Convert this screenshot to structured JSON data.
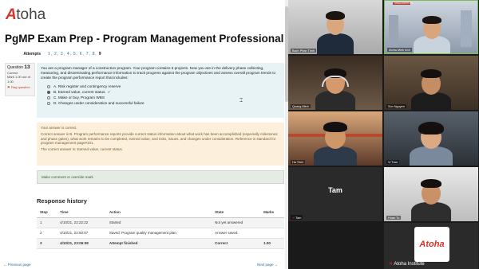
{
  "app": {
    "logo_mark": "A",
    "logo_text": "toha",
    "page_title": "PgMP Exam Prep - Program Management Professional"
  },
  "attempts": {
    "label": "Attempts",
    "numbers": "1, 2, 3, 4, 5, 6, 7, 8,",
    "current": "9"
  },
  "question_info": {
    "prefix": "Question",
    "number": "13",
    "status": "Correct",
    "mark": "Mark 1.00 out of 1.00",
    "flag": "Flag question"
  },
  "question": {
    "text": "You are a program manager of a construction program. Your program contains 5 projects. Now you are in the delivery phase collecting, measuring, and disseminating performance information to track progress against the program objectives and assess overall program trends to create the program performance report that includes:",
    "options": [
      {
        "letter": "A.",
        "text": "Risk register and contingency reserve",
        "selected": false
      },
      {
        "letter": "B.",
        "text": "Earned value, current status.",
        "selected": true,
        "mark": "✓"
      },
      {
        "letter": "C.",
        "text": "Make or buy, Program WBS",
        "selected": false
      },
      {
        "letter": "D.",
        "text": "Changes under consideration and successful failure",
        "selected": false
      }
    ]
  },
  "feedback": {
    "line1": "Your answer is correct.",
    "line2": "Correct answer is B. Program performance reports provide current status information about what work has been accomplished (especially milestones and phase gates), what work remains to be completed, earned value, and risks, issues, and changes under consideration. Reference is standard for program management page#101.",
    "line3": "The correct answer is: Earned value, current status."
  },
  "comment": {
    "label": "Make comment or override mark"
  },
  "response_history": {
    "title": "Response history",
    "columns": [
      "Step",
      "Time",
      "Action",
      "State",
      "Marks"
    ],
    "rows": [
      {
        "step": "1",
        "time": "4/10/21, 22:22:22",
        "action": "Started",
        "state": "Not yet answered",
        "marks": ""
      },
      {
        "step": "2",
        "time": "4/10/21, 22:50:07",
        "action": "Saved: Program quality management plan.",
        "state": "Answer saved",
        "marks": ""
      },
      {
        "step": "3",
        "time": "4/10/21, 23:06:08",
        "action": "Attempt finished",
        "state": "Correct",
        "marks": "1.00"
      }
    ]
  },
  "nav": {
    "prev": "← Previous page",
    "next": "Next page →"
  },
  "video": {
    "participants": [
      {
        "name": "Bach Phan Trinh"
      },
      {
        "name": "Atoha Minh Anh",
        "banner": "ATOHA INSTITUTE"
      },
      {
        "name": "Quang Minh"
      },
      {
        "name": "Son Nguyen"
      },
      {
        "name": "Ha Trinh"
      },
      {
        "name": "Vi Tran"
      },
      {
        "name": "Tam",
        "tile_text": "Tam"
      },
      {
        "name": "Hoan Tu"
      },
      {
        "name": "Atoha Institute",
        "brand": "Atoha"
      }
    ]
  },
  "colors": {
    "accent": "#d8332a",
    "question_bg": "#e7f3f5",
    "feedback_bg": "#fcefdc",
    "active_speaker": "#7bbf4a"
  }
}
